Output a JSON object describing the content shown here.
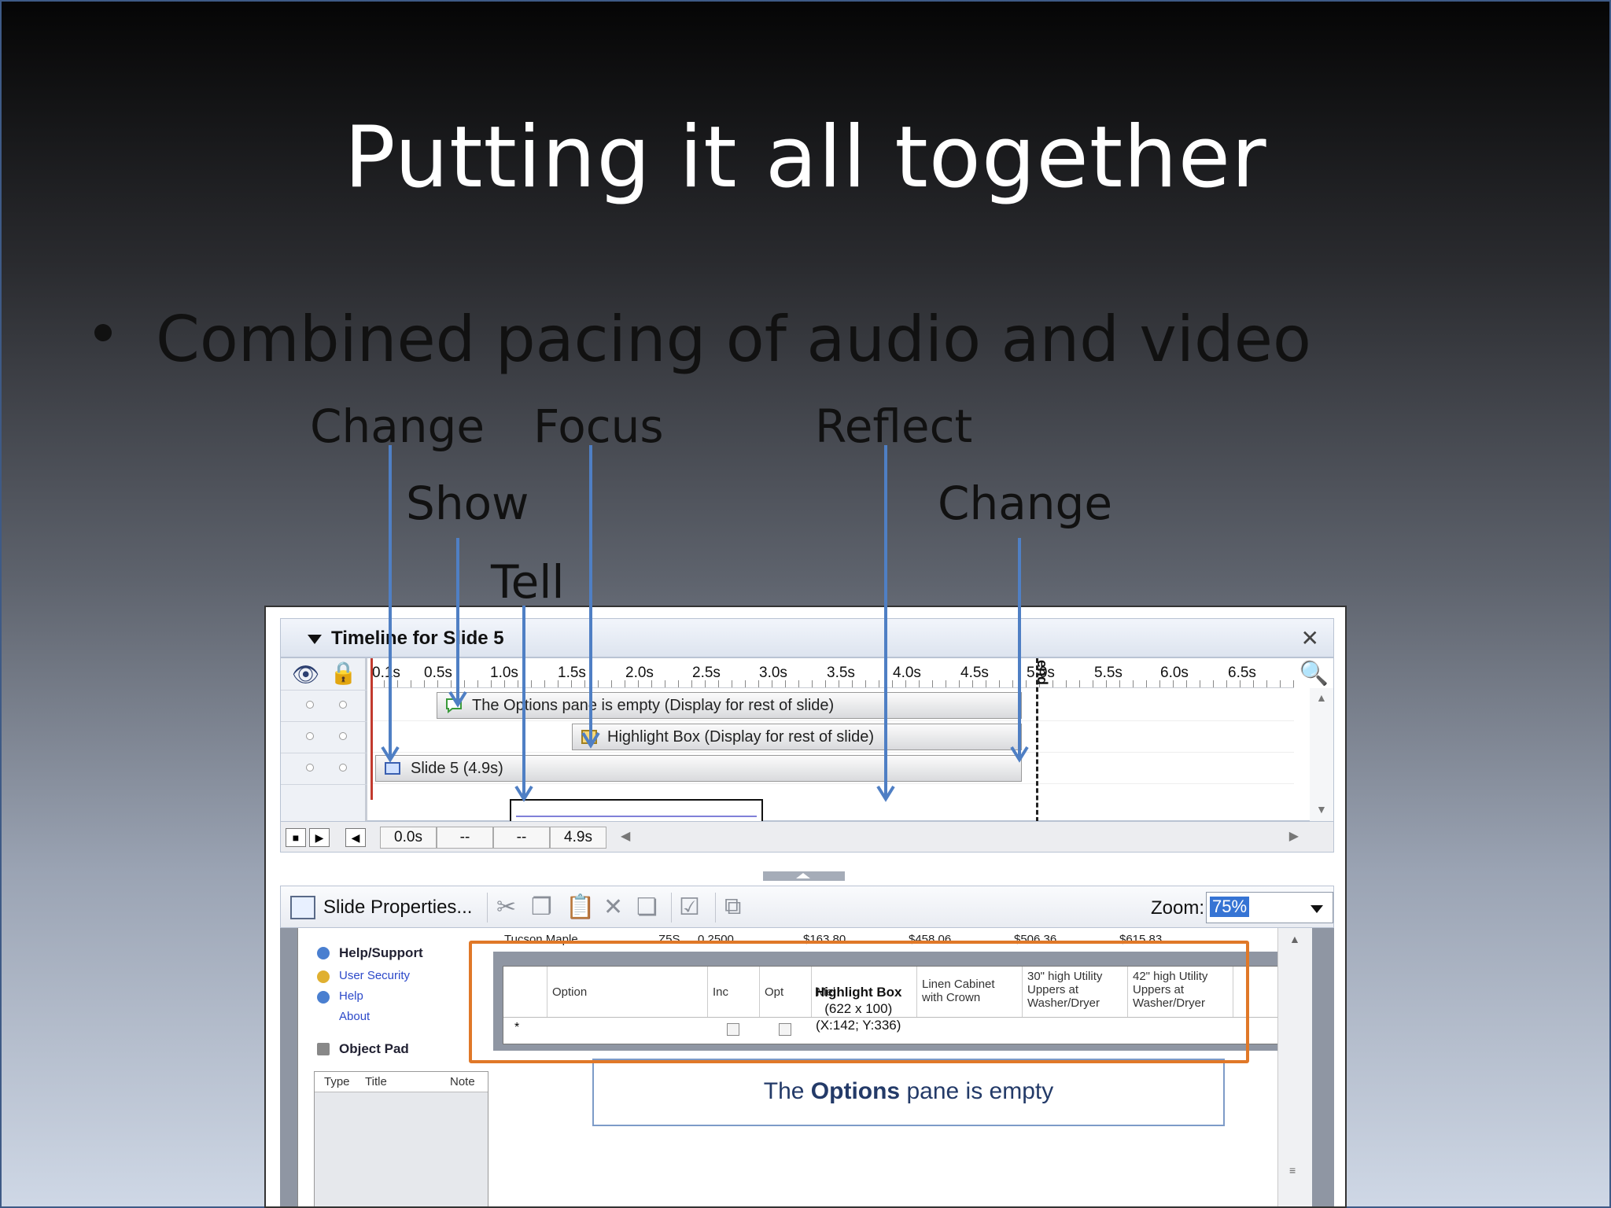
{
  "slide": {
    "title": "Putting it all together",
    "bullet": "Combined pacing of audio and video"
  },
  "cues": {
    "change_1": "Change",
    "focus": "Focus",
    "reflect": "Reflect",
    "show": "Show",
    "change_2": "Change",
    "tell": "Tell"
  },
  "timeline": {
    "title": "Timeline for Slide 5",
    "close_icon": "close-icon",
    "ruler_labels": [
      "0.1s",
      "0.5s",
      "1.0s",
      "1.5s",
      "2.0s",
      "2.5s",
      "3.0s",
      "3.5s",
      "4.0s",
      "4.5s",
      "5.0s",
      "5.5s",
      "6.0s",
      "6.5s"
    ],
    "end_label": "end",
    "bars": [
      {
        "label": "The Options pane is empty (Display for rest of slide)",
        "icon": "caption-icon"
      },
      {
        "label": "Highlight Box (Display for rest of slide)",
        "icon": "highlight-box-icon"
      },
      {
        "label": "Slide 5 (4.9s)",
        "icon": "slide-icon"
      }
    ],
    "controls": {
      "current_time": "0.0s",
      "start": "--",
      "end": "--",
      "duration": "4.9s"
    }
  },
  "toolbar": {
    "slide_properties": "Slide Properties...",
    "zoom_label": "Zoom:",
    "zoom_value": "75%"
  },
  "app": {
    "side_help": "Help/Support",
    "side_links": [
      "User Security",
      "Help",
      "About"
    ],
    "side_objpad": "Object Pad",
    "objpad_cols": [
      "Type",
      "Title",
      "Note"
    ],
    "top_row": [
      "Tucson Maple",
      "Z5S",
      "0.2500",
      "$163.80",
      "$458.06",
      "$506.36",
      "$615.83"
    ],
    "grid_headers": [
      "Option",
      "Inc",
      "Opt",
      "Mel",
      "Linen Cabinet with Crown",
      "30\" high Utility Uppers at Washer/Dryer",
      "42\" high Utility Uppers at Washer/Dryer"
    ],
    "highlight_tip_1": "Highlight Box",
    "highlight_tip_2": "(622 x 100)",
    "highlight_tip_3": "(X:142; Y:336)",
    "new_row_marker": "*",
    "options_pre": "The ",
    "options_bold": "Options",
    "options_post": " pane is empty"
  },
  "colors": {
    "arrow": "#4f7fc4",
    "highlight_border": "#e07828",
    "playhead": "#c23a2e"
  }
}
